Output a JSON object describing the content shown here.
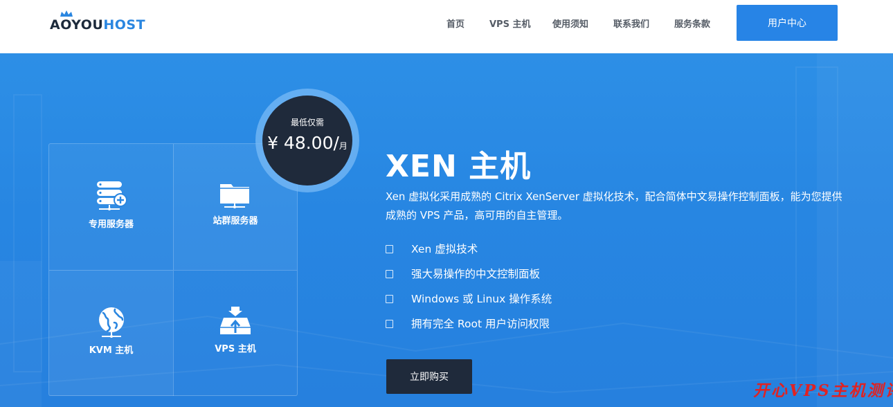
{
  "header": {
    "logo": {
      "part1": "AOYOU",
      "part2": "HOST"
    },
    "nav": [
      {
        "label": "首页"
      },
      {
        "label": "VPS 主机"
      },
      {
        "label": "使用须知"
      },
      {
        "label": "联系我们"
      },
      {
        "label": "服务条款"
      }
    ],
    "user_center_label": "用户中心"
  },
  "price_badge": {
    "caption": "最低仅需",
    "price": "¥ 48.00/",
    "unit": "月"
  },
  "tiles": [
    {
      "label": "专用服务器",
      "icon": "dedicated-server-icon"
    },
    {
      "label": "站群服务器",
      "icon": "folder-server-icon"
    },
    {
      "label": "KVM 主机",
      "icon": "globe-icon"
    },
    {
      "label": "VPS 主机",
      "icon": "upload-drive-icon"
    }
  ],
  "hero": {
    "title": "XEN 主机",
    "description": "Xen 虚拟化采用成熟的 Citrix XenServer 虚拟化技术，配合简体中文易操作控制面板，能为您提供成熟的 VPS 产品，高可用的自主管理。",
    "features": [
      {
        "text": "Xen 虚拟技术"
      },
      {
        "text": "强大易操作的中文控制面板"
      },
      {
        "text": "Windows 或 Linux 操作系统"
      },
      {
        "text": "拥有完全 Root 用户访问权限"
      }
    ],
    "buy_label": "立即购买"
  },
  "watermark": "开心VPS主机测评",
  "colors": {
    "brand_blue": "#2784e6",
    "dark_navy": "#1f2a3b",
    "hero_bg": "#2786e2",
    "watermark_red": "#e02222"
  }
}
